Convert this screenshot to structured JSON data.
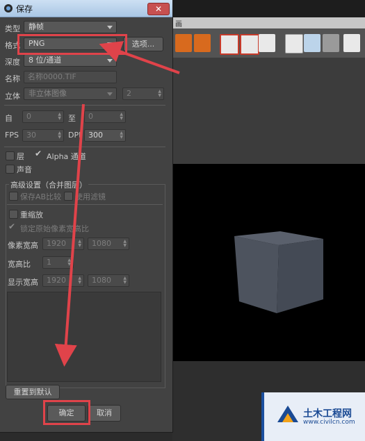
{
  "dialog": {
    "title": "保存",
    "close": "✕",
    "type_label": "类型",
    "type_value": "静帧",
    "format_label": "格式",
    "format_value": "PNG",
    "options_button": "选项...",
    "depth_label": "深度",
    "depth_value": "8 位/通道",
    "name_label": "名称",
    "name_value": "名称0000.TIF",
    "stereo_label": "立体",
    "stereo_value": "非立体图像",
    "stereo_count": "2",
    "from_label": "自",
    "from_value": "0",
    "to_label": "至",
    "to_value": "0",
    "fps_label": "FPS",
    "fps_value": "30",
    "dpi_label": "DPI",
    "dpi_value": "300",
    "layers_label": "层",
    "alpha_label": "Alpha 通道",
    "sound_label": "声音",
    "advanced_title": "高级设置（合并图层）",
    "save_ab_label": "保存AB比较",
    "use_filter_label": "使用滤镜",
    "rescale_label": "重缩放",
    "lock_ratio_label": "锁定原始像素宽高比",
    "pixel_size_label": "像素宽高",
    "pixel_w": "1920",
    "pixel_h": "1080",
    "aspect_label": "宽高比",
    "aspect_value": "1",
    "display_size_label": "显示宽高",
    "display_w": "1920",
    "display_h": "1080",
    "reset_button": "重置到默认",
    "ok_button": "确定",
    "cancel_button": "取消"
  },
  "background": {
    "band_label": "画"
  },
  "watermark": {
    "title": "土木工程网",
    "url": "www.civilcn.com"
  },
  "colors": {
    "highlight": "#e0434a",
    "dialog_bg": "#424242",
    "titlebar": "#b8d1ea",
    "cube": "#4f5663"
  }
}
